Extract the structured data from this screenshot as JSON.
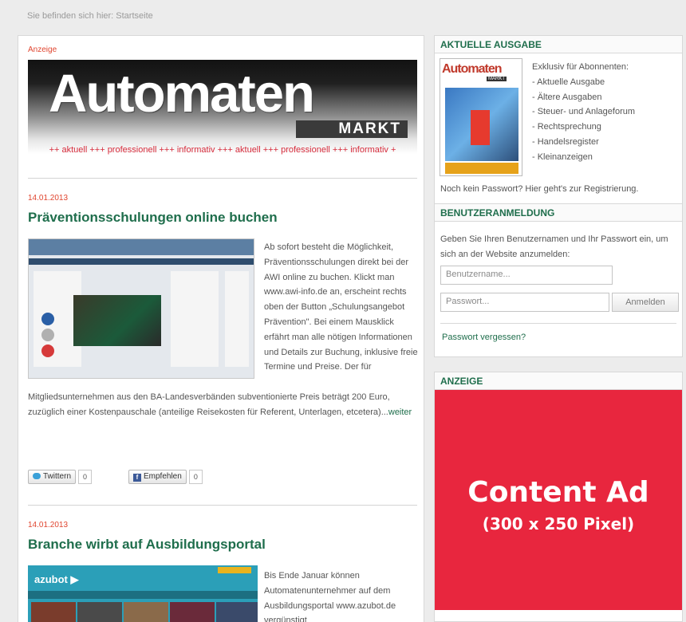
{
  "breadcrumb": "Sie befinden sich hier: Startseite",
  "main": {
    "ad_label": "Anzeige",
    "banner": {
      "title": "Automaten",
      "subtitle": "MARKT",
      "ticker": "++ aktuell +++ professionell +++ informativ +++ aktuell +++ professionell +++ informativ +"
    },
    "articles": [
      {
        "date": "14.01.2013",
        "title": "Präventionsschulungen online buchen",
        "text_side": "Ab sofort besteht die Möglichkeit, Präventionsschulungen direkt bei der AWI online zu buchen. Klickt man www.awi-info.de an, erscheint rechts oben der Button „Schulungsangebot Prävention\". Bei einem Mausklick erfährt man alle nötigen Informationen und Details zur Buchung, inklusive freie Termine und Preise. Der für",
        "text_full": "Mitgliedsunternehmen aus den BA-Landesverbänden subventionierte Preis beträgt 200 Euro, zuzüglich einer Kostenpauschale (anteilige Reisekosten für Referent, Unterlagen, etcetera)...",
        "more": "weiter",
        "twitter_label": "Twittern",
        "twitter_count": "0",
        "facebook_label": "Empfehlen",
        "facebook_count": "0"
      },
      {
        "date": "14.01.2013",
        "title": "Branche wirbt auf Ausbildungsportal",
        "thumb_logo": "azubot",
        "text_side": "Bis Ende Januar können Automatenunternehmer auf dem Ausbildungsportal www.azubot.de vergünstigt"
      }
    ]
  },
  "sidebar": {
    "current_issue": {
      "heading": "AKTUELLE AUSGABE",
      "cover_title": "Automaten",
      "cover_sub": "MARKT",
      "intro": "Exklusiv für Abonnenten:",
      "items": [
        "- Aktuelle Ausgabe",
        "- Ältere Ausgaben",
        "- Steuer- und Anlageforum",
        "- Rechtsprechung",
        "- Handelsregister",
        "- Kleinanzeigen"
      ],
      "register_text": "Noch kein Passwort? Hier geht's zur Registrierung."
    },
    "login": {
      "heading": "BENUTZERANMELDUNG",
      "text": "Geben Sie Ihren Benutzernamen und Ihr Passwort ein, um sich an der Website anzumelden:",
      "username_placeholder": "Benutzername...",
      "password_placeholder": "Passwort...",
      "button": "Anmelden",
      "forgot": "Passwort vergessen?"
    },
    "ad": {
      "heading": "ANZEIGE",
      "line1": "Content Ad",
      "line2": "(300 x 250 Pixel)"
    }
  },
  "colors": {
    "accent_green": "#1f6e4c",
    "date_red": "#e0452f",
    "ad_red": "#e8263e"
  }
}
